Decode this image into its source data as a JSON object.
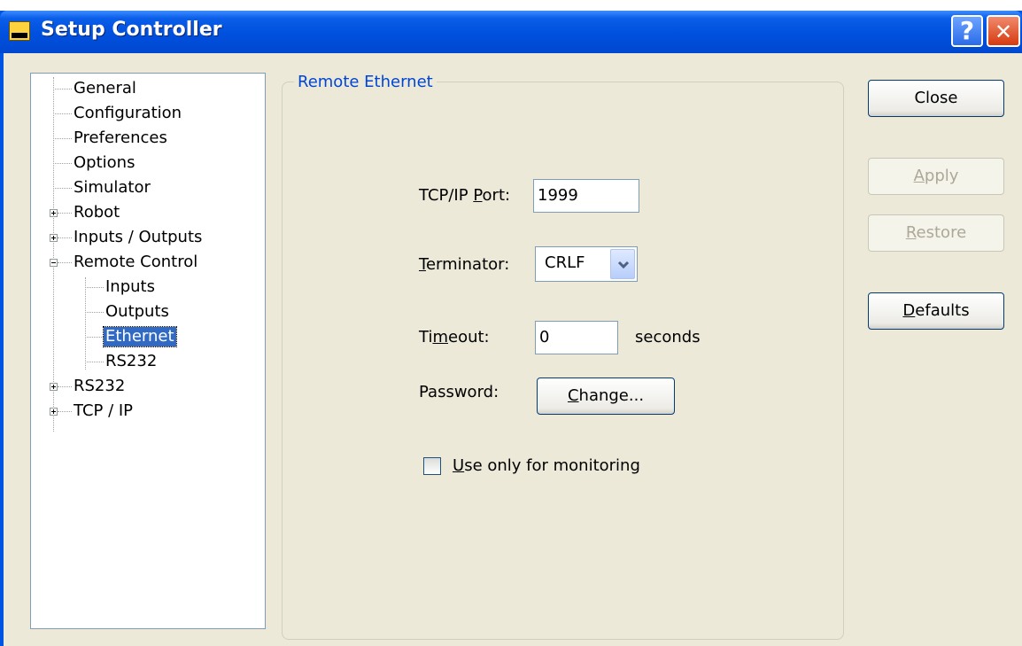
{
  "window": {
    "title": "Setup Controller",
    "help_glyph": "?",
    "close_glyph": "✕",
    "icons": {
      "app": "setup-controller-icon",
      "help": "help-icon",
      "close": "close-icon"
    }
  },
  "tree": {
    "items": [
      {
        "label": "General",
        "level": 0,
        "expander": "none"
      },
      {
        "label": "Configuration",
        "level": 0,
        "expander": "none"
      },
      {
        "label": "Preferences",
        "level": 0,
        "expander": "none"
      },
      {
        "label": "Options",
        "level": 0,
        "expander": "none"
      },
      {
        "label": "Simulator",
        "level": 0,
        "expander": "none"
      },
      {
        "label": "Robot",
        "level": 0,
        "expander": "plus"
      },
      {
        "label": "Inputs / Outputs",
        "level": 0,
        "expander": "plus"
      },
      {
        "label": "Remote Control",
        "level": 0,
        "expander": "minus"
      },
      {
        "label": "Inputs",
        "level": 1,
        "expander": "none"
      },
      {
        "label": "Outputs",
        "level": 1,
        "expander": "none"
      },
      {
        "label": "Ethernet",
        "level": 1,
        "expander": "none",
        "selected": true
      },
      {
        "label": "RS232",
        "level": 1,
        "expander": "none"
      },
      {
        "label": "RS232",
        "level": 0,
        "expander": "plus"
      },
      {
        "label": "TCP / IP",
        "level": 0,
        "expander": "plus"
      }
    ]
  },
  "panel": {
    "group_title": "Remote Ethernet",
    "port": {
      "label_before": "TCP/IP ",
      "label_mnemonic": "P",
      "label_after": "ort:",
      "value": "1999"
    },
    "terminator": {
      "label_mnemonic": "T",
      "label_after": "erminator:",
      "value": "CRLF",
      "icon": "dropdown-arrow-icon"
    },
    "timeout": {
      "label_before": "Ti",
      "label_mnemonic": "m",
      "label_after": "eout:",
      "value": "0",
      "unit": "seconds"
    },
    "password": {
      "label": "Password:",
      "button_mnemonic": "C",
      "button_rest": "hange..."
    },
    "monitoring": {
      "mnemonic": "U",
      "rest": "se only for monitoring",
      "checked": false
    }
  },
  "buttons": {
    "close": {
      "label": "Close",
      "enabled": true
    },
    "apply": {
      "mnemonic": "A",
      "rest": "pply",
      "enabled": false
    },
    "restore": {
      "mnemonic": "R",
      "rest": "estore",
      "enabled": false
    },
    "defaults": {
      "mnemonic": "D",
      "rest": "efaults",
      "enabled": true
    }
  },
  "colors": {
    "title_bar": "#0054e3",
    "dialog_face": "#ece9d8",
    "group_title": "#0046d5",
    "selection": "#316ac5"
  }
}
